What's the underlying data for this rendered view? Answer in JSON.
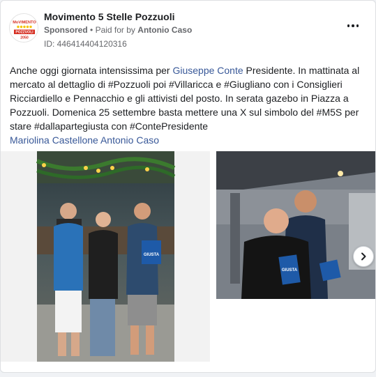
{
  "post": {
    "page_name": "Movimento 5 Stelle Pozzuoli",
    "sponsored_label": "Sponsored",
    "separator": "•",
    "paid_for_by_prefix": "Paid for by",
    "paid_for_by_name": "Antonio Caso",
    "ad_id": "ID: 446414404120316",
    "avatar_logo_text": {
      "top": "MoVIMENTO",
      "city": "POZZUOLI",
      "year": "2050"
    },
    "body": {
      "t1": "Anche oggi giornata intensissima per ",
      "link1": "Giuseppe Conte",
      "t2": " Presidente. In mattinata al mercato al dettaglio di #Pozzuoli poi #Villaricca e #Giugliano con i Consiglieri Ricciardiello e Pennacchio e gli attivisti del posto. In serata gazebo in Piazza a Pozzuoli. Domenica 25 settembre basta mettere una X sul simbolo del #M5S per stare #dallapartegiusta con #ContePresidente"
    },
    "tags": [
      "Mariolina Castellone",
      "Antonio Caso"
    ],
    "images": [
      {
        "icon": "group-photo",
        "caption_on_flyer": "GIUSTA"
      },
      {
        "icon": "two-men-photo",
        "caption_on_flyer": "GIUSTA"
      }
    ]
  },
  "colors": {
    "link": "#385898",
    "secondary_text": "#65676b",
    "m5s_red": "#d52b1e",
    "m5s_yellow": "#f5c400"
  }
}
